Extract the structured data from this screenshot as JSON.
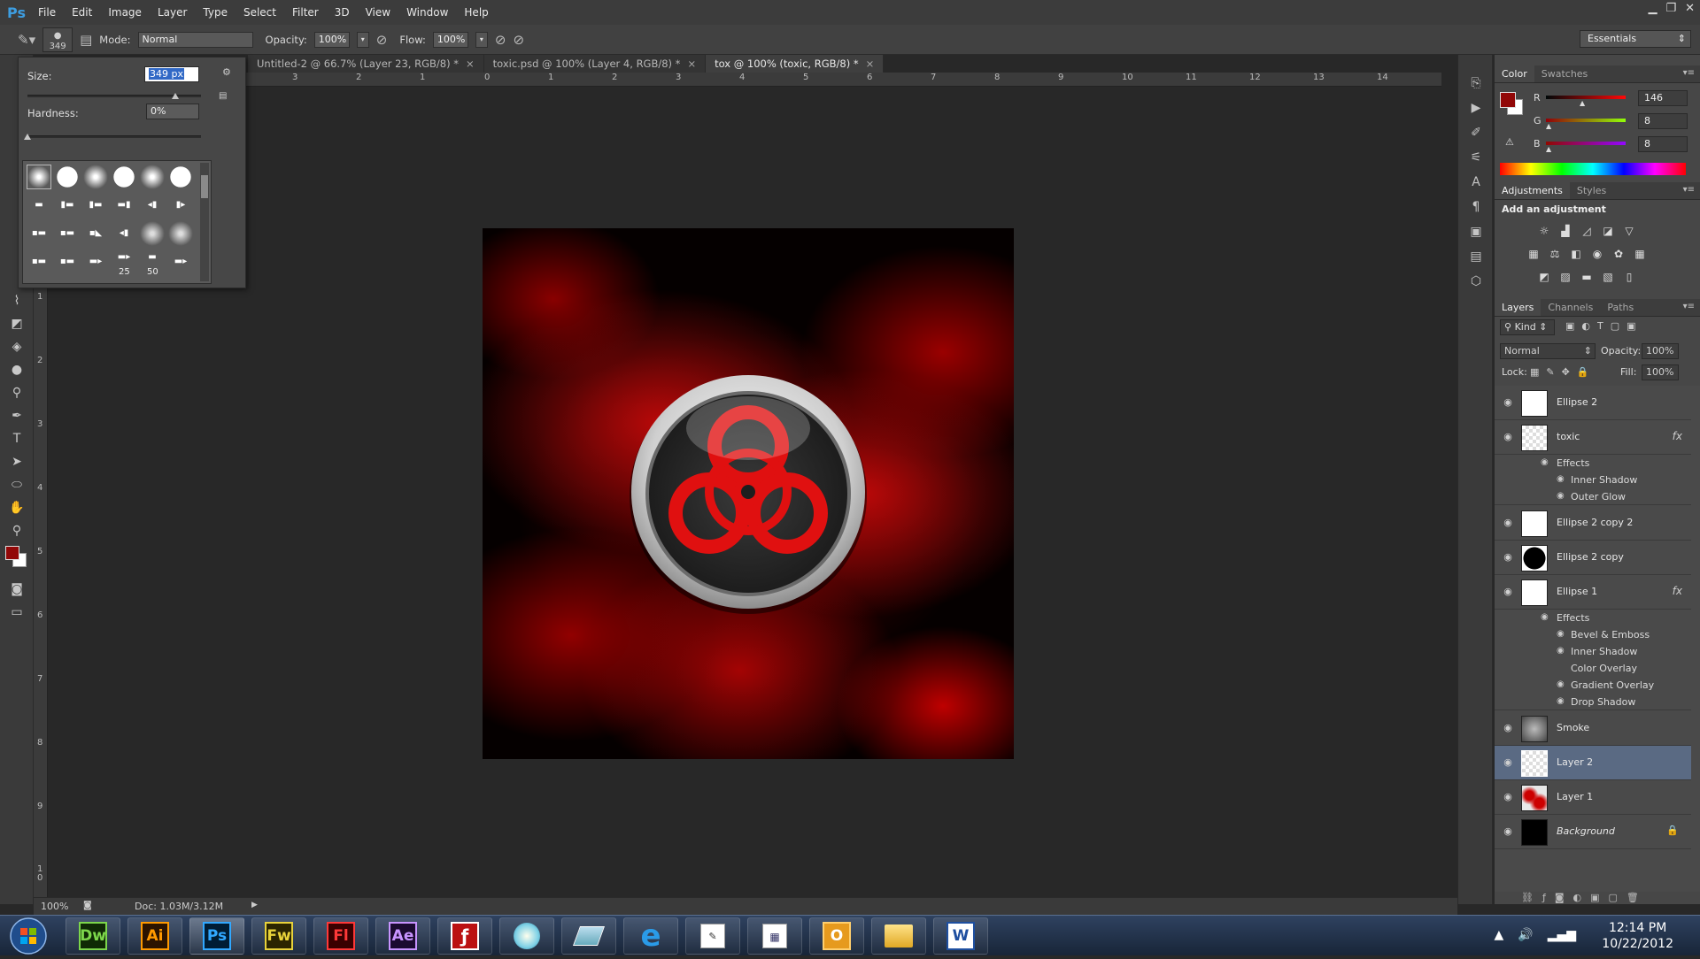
{
  "app": {
    "logo": "Ps"
  },
  "menu": [
    "File",
    "Edit",
    "Image",
    "Layer",
    "Type",
    "Select",
    "Filter",
    "3D",
    "View",
    "Window",
    "Help"
  ],
  "options": {
    "brush_size": "349",
    "mode_label": "Mode:",
    "mode_value": "Normal",
    "opacity_label": "Opacity:",
    "opacity_value": "100%",
    "flow_label": "Flow:",
    "flow_value": "100%",
    "workspace": "Essentials"
  },
  "brush_popup": {
    "size_label": "Size:",
    "size_value": "349 px",
    "size_level": 0.85,
    "hardness_label": "Hardness:",
    "hardness_value": "0%",
    "preset_label_25": "25",
    "preset_label_50": "50"
  },
  "tabs": [
    {
      "label": "Untitled-2 @ 66.7% (Layer 23, RGB/8) *"
    },
    {
      "label": "toxic.psd @ 100% (Layer 4, RGB/8) *"
    },
    {
      "label": "tox @ 100% (toxic, RGB/8) *"
    }
  ],
  "ruler_top": [
    "3",
    "2",
    "1",
    "0",
    "1",
    "2",
    "3",
    "4",
    "5",
    "6",
    "7",
    "8",
    "9",
    "10",
    "11",
    "12",
    "13",
    "14"
  ],
  "ruler_left": [
    "1",
    "2",
    "3",
    "4",
    "5",
    "6",
    "7",
    "8",
    "9",
    "1\n0"
  ],
  "color_panel": {
    "tabs": [
      "Color",
      "Swatches"
    ],
    "r_label": "R",
    "g_label": "G",
    "b_label": "B",
    "r": "146",
    "g": "8",
    "b": "8",
    "fg_color": "#920808"
  },
  "adjustments": {
    "tabs": [
      "Adjustments",
      "Styles"
    ],
    "heading": "Add an adjustment"
  },
  "layers_panel": {
    "tabs": [
      "Layers",
      "Channels",
      "Paths"
    ],
    "kind": "Kind",
    "blend": "Normal",
    "opacity_label": "Opacity:",
    "opacity": "100%",
    "lock_label": "Lock:",
    "fill_label": "Fill:",
    "fill": "100%",
    "layers": [
      {
        "name": "Ellipse 2"
      },
      {
        "name": "toxic",
        "fx": "fx",
        "effects_label": "Effects",
        "effects": [
          "Inner Shadow",
          "Outer Glow"
        ]
      },
      {
        "name": "Ellipse 2 copy 2"
      },
      {
        "name": "Ellipse 2 copy"
      },
      {
        "name": "Ellipse 1",
        "fx": "fx",
        "effects_label": "Effects",
        "effects": [
          "Bevel & Emboss",
          "Inner Shadow",
          "Color Overlay",
          "Gradient Overlay",
          "Drop Shadow"
        ]
      },
      {
        "name": "Smoke"
      },
      {
        "name": "Layer 2"
      },
      {
        "name": "Layer 1"
      },
      {
        "name": "Background"
      }
    ]
  },
  "status": {
    "zoom": "100%",
    "doc": "Doc: 1.03M/3.12M"
  },
  "taskbar": {
    "apps": [
      "Dw",
      "Ai",
      "Ps",
      "Fw",
      "Fl",
      "Ae"
    ],
    "time": "12:14 PM",
    "date": "10/22/2012"
  }
}
